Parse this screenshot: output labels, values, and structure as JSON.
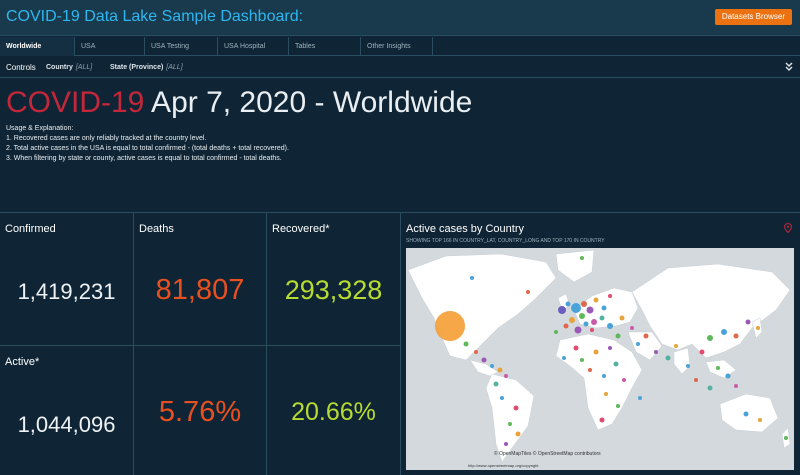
{
  "header": {
    "title": "COVID-19 Data Lake Sample Dashboard:",
    "datasets_button": "Datasets Browser"
  },
  "tabs": [
    {
      "label": "Worldwide",
      "active": true
    },
    {
      "label": "USA",
      "active": false
    },
    {
      "label": "USA Testing",
      "active": false
    },
    {
      "label": "USA Hospital",
      "active": false
    },
    {
      "label": "Tables",
      "active": false
    },
    {
      "label": "Other Insights",
      "active": false
    }
  ],
  "controls": {
    "label": "Controls",
    "country": {
      "label": "Country",
      "value": "[ALL]"
    },
    "state": {
      "label": "State (Province)",
      "value": "[ALL]"
    }
  },
  "headline": {
    "highlight": "COVID-19",
    "rest": " Apr 7, 2020 - Worldwide"
  },
  "usage": {
    "title": "Usage & Explanation:",
    "lines": [
      "1. Recovered cases are only reliably tracked at the country level.",
      "2. Total active cases in the USA is equal to total confirmed - (total deaths + total recovered).",
      "3. When filtering by state or county, active cases is equal to total confirmed - total deaths."
    ]
  },
  "kpis": {
    "confirmed": {
      "title": "Confirmed",
      "value": "1,419,231"
    },
    "deaths": {
      "title": "Deaths",
      "value": "81,807"
    },
    "recovered": {
      "title": "Recovered*",
      "value": "293,328"
    },
    "active": {
      "title": "Active*",
      "value": "1,044,096"
    },
    "death_rate": {
      "value": "5.76%"
    },
    "recovery_rate": {
      "value": "20.66%"
    }
  },
  "map": {
    "title": "Active cases by Country",
    "subtitle": "SHOWING TOP 166 IN COUNTRY_LAT, COUNTRY_LONG AND TOP 170 IN COUNTRY",
    "attribution": "© OpenMapTiles © OpenStreetMap contributors",
    "attribution_url": "http://www.openstreetmap.org/copyright"
  },
  "colors": {
    "accent_blue": "#2fb6f0",
    "button_orange": "#ec7211",
    "headline_red": "#c2273a",
    "deaths_orange": "#e8501f",
    "recovered_green": "#b7db30",
    "background": "#0f2535"
  },
  "icons": {
    "collapse": "chevron-double-down-icon",
    "map_pin": "map-pin-icon"
  }
}
